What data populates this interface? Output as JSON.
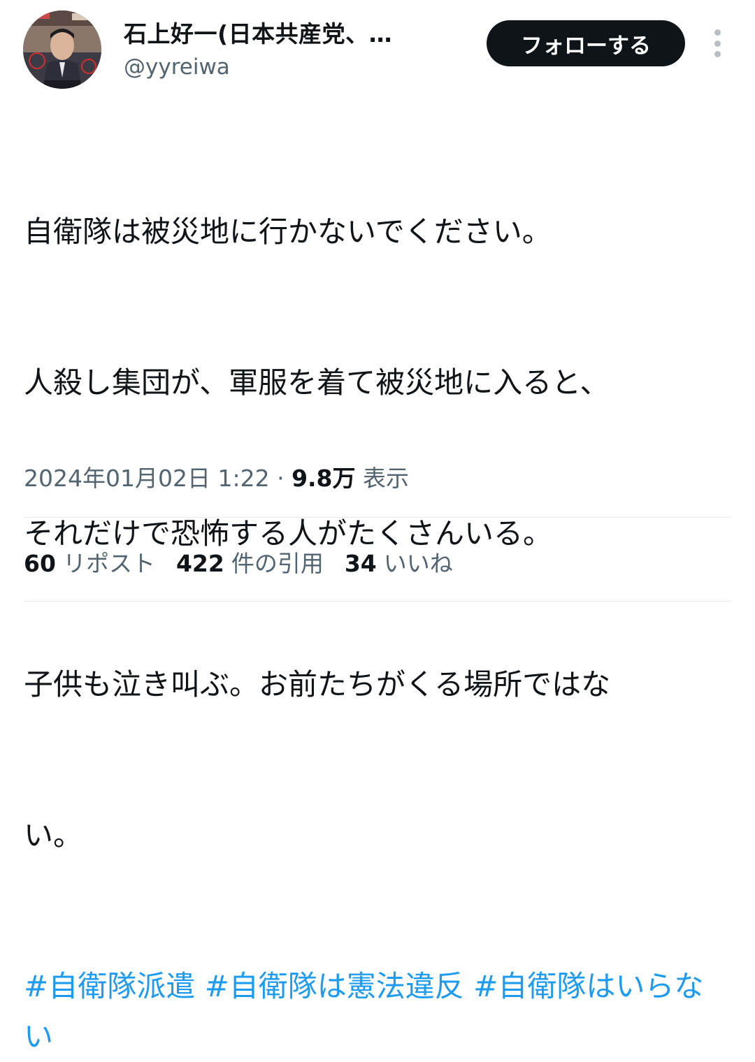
{
  "user": {
    "display_name": "石上好一(日本共産党、…",
    "handle": "@yyreiwa"
  },
  "follow_button_label": "フォローする",
  "tweet": {
    "text_lines": [
      "自衛隊は被災地に行かないでください。",
      "人殺し集団が、軍服を着て被災地に入ると、",
      "それだけで恐怖する人がたくさんいる。",
      "子供も泣き叫ぶ。お前たちがくる場所ではな",
      "い。"
    ],
    "hashtags": [
      "#自衛隊派遣",
      "#自衛隊は憲法違反",
      "#自衛隊はいらない"
    ]
  },
  "meta": {
    "datetime": "2024年01月02日 1:22",
    "separator": "·",
    "views_count": "9.8万",
    "views_label": "表示"
  },
  "stats": {
    "reposts": {
      "count": "60",
      "label": "リポスト"
    },
    "quotes": {
      "count": "422",
      "label": "件の引用"
    },
    "likes": {
      "count": "34",
      "label": "いいね"
    }
  },
  "colors": {
    "link": "#1d9bf0",
    "text": "#0f1419",
    "secondary": "#536471",
    "button_bg": "#0f1419"
  },
  "icons": {
    "more": "more-vertical-icon"
  }
}
